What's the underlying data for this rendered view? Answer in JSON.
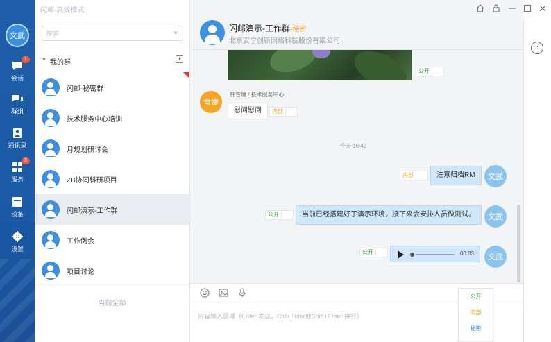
{
  "window": {
    "title": "闪邮-高效模式",
    "controls": [
      "home",
      "lock",
      "minimize",
      "maximize",
      "close"
    ]
  },
  "user": {
    "avatar_text": "文武"
  },
  "nav": [
    {
      "icon": "chat-icon",
      "label": "会话",
      "badge": "1"
    },
    {
      "icon": "group-icon",
      "label": "群组",
      "active": true
    },
    {
      "icon": "contacts-icon",
      "label": "通讯录"
    },
    {
      "icon": "apps-icon",
      "label": "服务",
      "badge": "3"
    },
    {
      "icon": "device-icon",
      "label": "设备"
    },
    {
      "icon": "settings-icon",
      "label": "设置"
    }
  ],
  "search": {
    "placeholder": "搜索"
  },
  "groups_section": {
    "title": "我的群"
  },
  "groups": [
    {
      "name": "闪邮-秘密群"
    },
    {
      "name": "技术服务中心培训"
    },
    {
      "name": "月规划研讨会"
    },
    {
      "name": "ZB协同科研项目"
    },
    {
      "name": "闪邮演示-工作群",
      "active": true
    },
    {
      "name": "工作例会"
    },
    {
      "name": "项目讨论"
    }
  ],
  "list_footer": "当前全部",
  "chat": {
    "title": "闪邮演示-工作群",
    "title_tag": "-秘密",
    "subtitle": "北京安宁创新网络科技股份有限公司",
    "image_tag": "公开",
    "sender_avatar": "雪婕",
    "sender_name": "韩雪婕 / 技术服务中心",
    "msg1_text": "慰问慰问",
    "msg1_tag": "内部",
    "time_divider": "今天 16:42",
    "msg2_text": "注意归档RM",
    "msg2_tag": "内部",
    "msg3_text": "当前已经搭建好了演示环境，接下来会安排人员做测试。",
    "msg3_tag": "公开",
    "voice_tag": "公开",
    "voice_duration": "00:03",
    "self_avatar": "文武"
  },
  "input": {
    "placeholder": "内容输入区域（Enter 发送，Ctrl+Enter或Shift+Enter 换行）",
    "tools": [
      "emoji-icon",
      "image-icon",
      "mic-icon"
    ]
  },
  "security_popup": [
    "公开",
    "内部",
    "秘密"
  ],
  "colors": {
    "rail": "#1f5ea8",
    "accent": "#3d8fe0",
    "public": "#3aa33a",
    "internal": "#e4a11b",
    "secret": "#3d8fe0",
    "self_bubble": "#cfe6fb"
  }
}
